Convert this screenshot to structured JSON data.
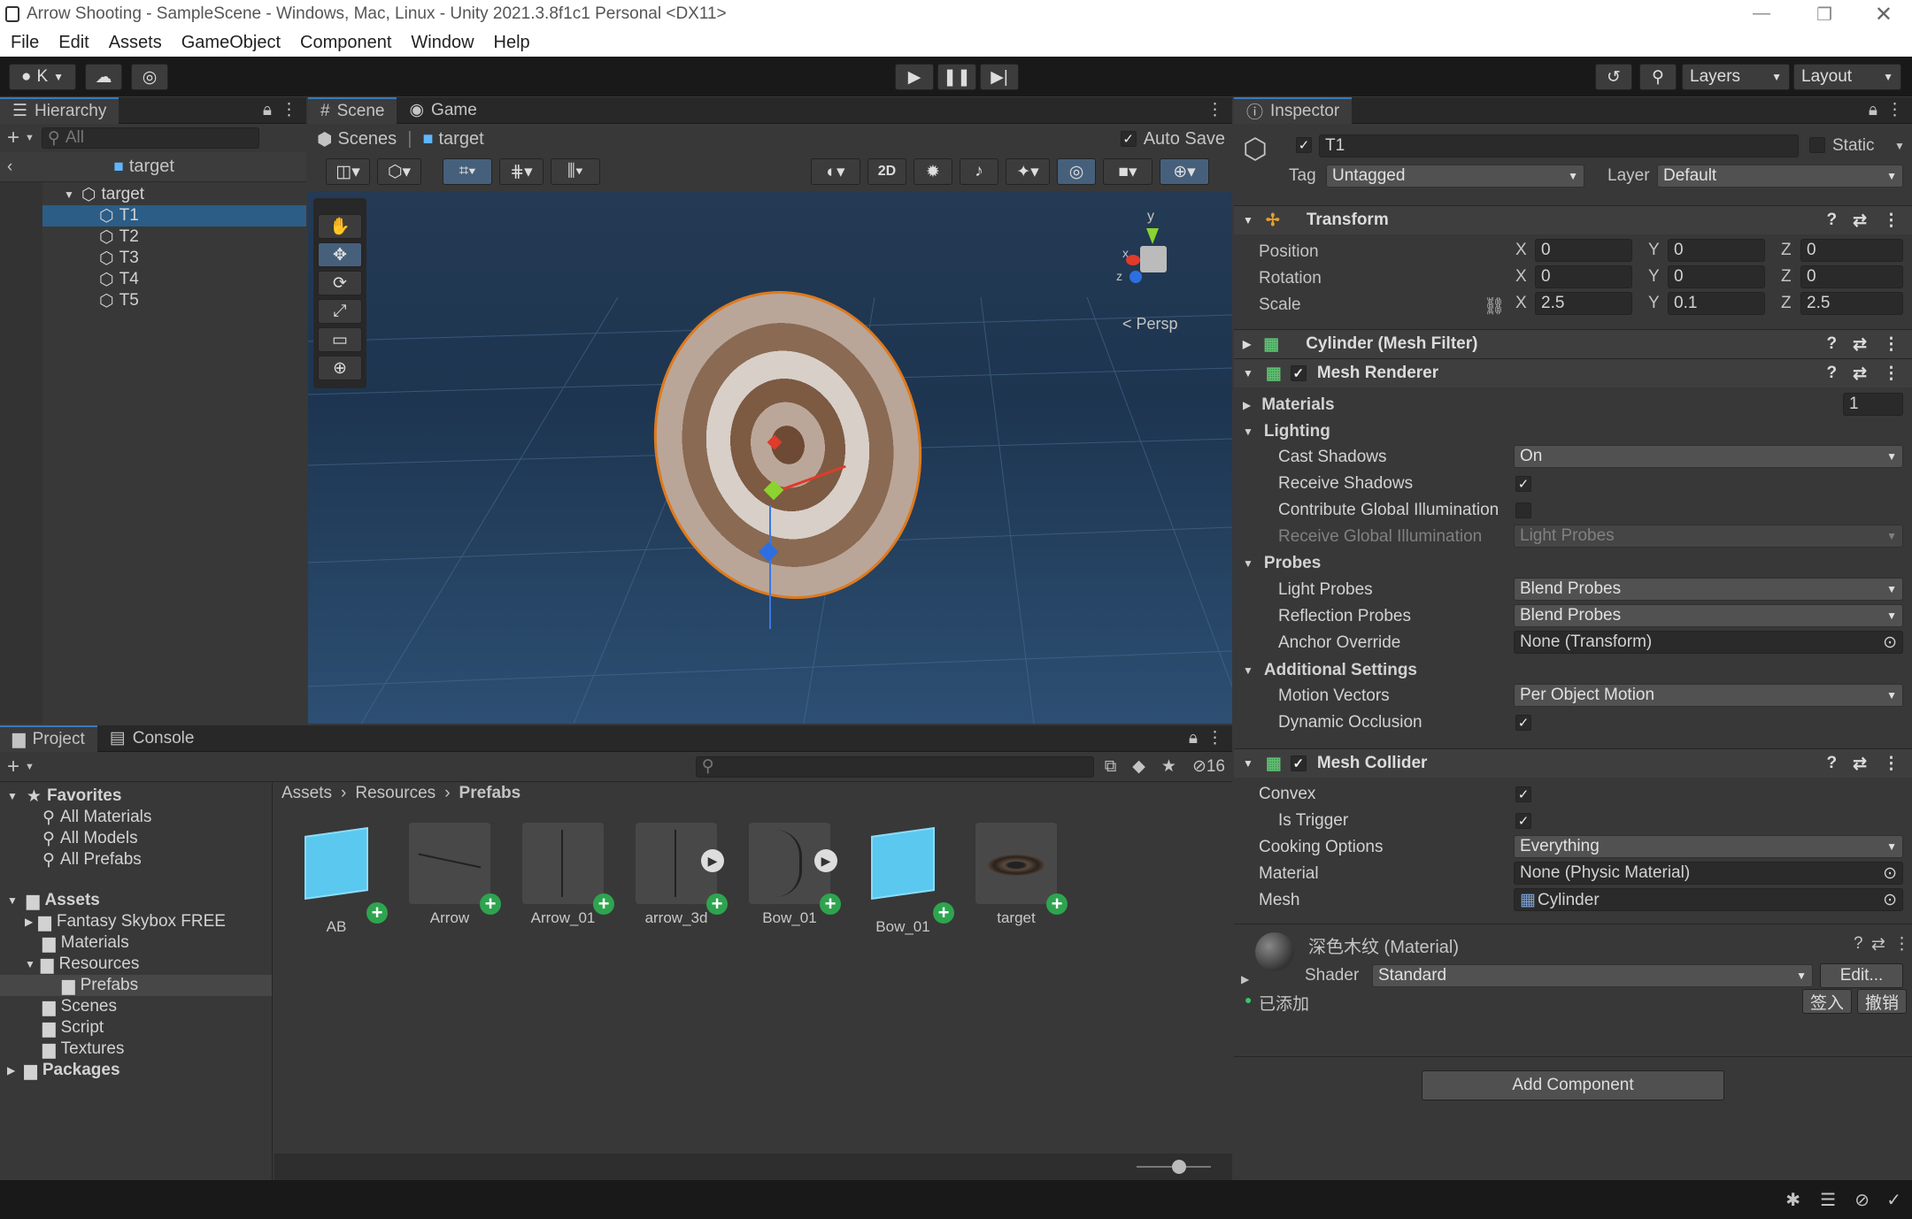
{
  "window": {
    "title": "Arrow Shooting - SampleScene - Windows, Mac, Linux - Unity 2021.3.8f1c1 Personal <DX11>"
  },
  "menu": [
    "File",
    "Edit",
    "Assets",
    "GameObject",
    "Component",
    "Window",
    "Help"
  ],
  "toolbar": {
    "account": "K",
    "layers": "Layers",
    "layout": "Layout"
  },
  "hierarchy": {
    "tab": "Hierarchy",
    "search_placeholder": "All",
    "scene": "target",
    "root": "target",
    "children": [
      "T1",
      "T2",
      "T3",
      "T4",
      "T5"
    ],
    "selected": "T1"
  },
  "scene_view": {
    "tabs": [
      "Scene",
      "Game"
    ],
    "breadcrumb_root": "Scenes",
    "breadcrumb_item": "target",
    "auto_save": "Auto Save",
    "mode_2d": "2D",
    "persp": "Persp",
    "axis": {
      "y": "y",
      "x": "x",
      "z": "z"
    }
  },
  "project": {
    "tabs": [
      "Project",
      "Console"
    ],
    "hidden_count": "16",
    "favorites_label": "Favorites",
    "favorites": [
      "All Materials",
      "All Models",
      "All Prefabs"
    ],
    "assets_label": "Assets",
    "assets": [
      "Fantasy Skybox FREE",
      "Materials",
      "Resources",
      "Prefabs",
      "Scenes",
      "Script",
      "Textures"
    ],
    "packages_label": "Packages",
    "breadcrumb": [
      "Assets",
      "Resources",
      "Prefabs"
    ],
    "items": [
      "AB",
      "Arrow",
      "Arrow_01",
      "arrow_3d",
      "Bow_01",
      "Bow_01",
      "target"
    ]
  },
  "inspector": {
    "tab": "Inspector",
    "object_name": "T1",
    "static": "Static",
    "tag_label": "Tag",
    "tag": "Untagged",
    "layer_label": "Layer",
    "layer": "Default",
    "transform": {
      "title": "Transform",
      "position_label": "Position",
      "rotation_label": "Rotation",
      "scale_label": "Scale",
      "position": {
        "x": "0",
        "y": "0",
        "z": "0"
      },
      "rotation": {
        "x": "0",
        "y": "0",
        "z": "0"
      },
      "scale": {
        "x": "2.5",
        "y": "0.1",
        "z": "2.5"
      }
    },
    "mesh_filter": "Cylinder (Mesh Filter)",
    "mesh_renderer": {
      "title": "Mesh Renderer",
      "materials_label": "Materials",
      "materials_count": "1",
      "lighting": "Lighting",
      "cast_shadows_label": "Cast Shadows",
      "cast_shadows": "On",
      "receive_shadows": "Receive Shadows",
      "contribute_gi": "Contribute Global Illumination",
      "receive_gi_label": "Receive Global Illumination",
      "receive_gi": "Light Probes",
      "probes": "Probes",
      "light_probes_label": "Light Probes",
      "light_probes": "Blend Probes",
      "reflection_probes_label": "Reflection Probes",
      "reflection_probes": "Blend Probes",
      "anchor_override_label": "Anchor Override",
      "anchor_override": "None (Transform)",
      "additional": "Additional Settings",
      "motion_vectors_label": "Motion Vectors",
      "motion_vectors": "Per Object Motion",
      "dynamic_occlusion": "Dynamic Occlusion"
    },
    "mesh_collider": {
      "title": "Mesh Collider",
      "convex": "Convex",
      "is_trigger": "Is Trigger",
      "cooking_label": "Cooking Options",
      "cooking": "Everything",
      "material_label": "Material",
      "material": "None (Physic Material)",
      "mesh_label": "Mesh",
      "mesh": "Cylinder"
    },
    "material": {
      "name": "深色木纹 (Material)",
      "shader_label": "Shader",
      "shader": "Standard",
      "edit": "Edit...",
      "added": "已添加",
      "sign_in": "签入",
      "undo": "撤销"
    },
    "add_component": "Add Component"
  }
}
